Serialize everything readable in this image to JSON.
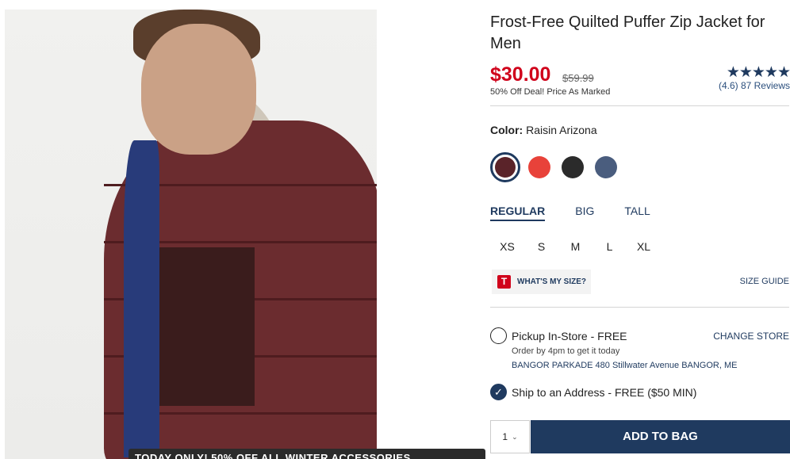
{
  "product": {
    "title": "Frost-Free Quilted Puffer Zip Jacket for Men",
    "price": "$30.00",
    "old_price": "$59.99",
    "deal_text": "50% Off Deal! Price As Marked",
    "rating_stars": "★★★★★",
    "rating_text": "(4.6) 87 Reviews",
    "rating_value": 4.6
  },
  "color": {
    "label": "Color:",
    "selected_name": "Raisin Arizona",
    "swatches": [
      {
        "name": "Raisin Arizona",
        "hex": "#5a2329",
        "selected": true
      },
      {
        "name": "Red",
        "hex": "#e8423a",
        "selected": false
      },
      {
        "name": "Black",
        "hex": "#2b2b2b",
        "selected": false
      },
      {
        "name": "Navy",
        "hex": "#4a5d7e",
        "selected": false
      }
    ]
  },
  "fits": [
    {
      "label": "REGULAR",
      "active": true
    },
    {
      "label": "BIG",
      "active": false
    },
    {
      "label": "TALL",
      "active": false
    }
  ],
  "sizes": [
    "XS",
    "S",
    "M",
    "L",
    "XL"
  ],
  "size_help": {
    "icon_letter": "T",
    "whats_my_size": "WHAT'S MY SIZE?",
    "size_guide": "SIZE GUIDE"
  },
  "fulfillment": {
    "pickup_label": "Pickup In-Store - FREE",
    "change_store": "CHANGE STORE",
    "order_by": "Order by 4pm to get it today",
    "store_address": "BANGOR PARKADE 480 Stillwater Avenue  BANGOR, ME",
    "ship_label": "Ship to an Address - FREE ($50 MIN)",
    "ship_selected": true
  },
  "cart": {
    "quantity": "1",
    "add_to_bag": "ADD TO BAG"
  },
  "promo": {
    "text": "TODAY ONLY! 50% OFF ALL WINTER ACCESSORIES"
  },
  "colors": {
    "brand_navy": "#1f3a5f",
    "sale_red": "#d0021b"
  }
}
